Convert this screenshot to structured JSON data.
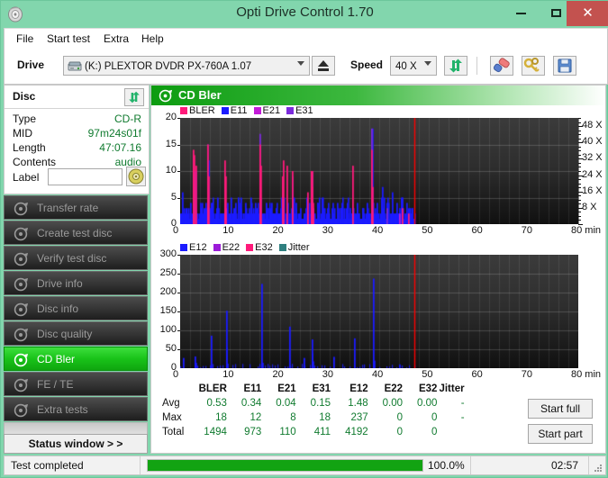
{
  "window": {
    "title": "Opti Drive Control 1.70",
    "icon": "disc-icon",
    "minimize": "minimize-icon",
    "maximize": "maximize-icon",
    "close": "✕"
  },
  "menu": {
    "items": [
      {
        "label": "File",
        "x": 8
      },
      {
        "label": "Start test",
        "x": 42
      },
      {
        "label": "Extra",
        "x": 105
      },
      {
        "label": "Help",
        "x": 147
      }
    ]
  },
  "toolbar": {
    "drive_label": "Drive",
    "drive_value": "(K:)   PLEXTOR DVDR   PX-760A 1.07",
    "eject_icon": "eject-icon",
    "speed_label": "Speed",
    "speed_value": "40 X",
    "refresh_icon": "refresh-icon",
    "erase_icon": "eraser-icon",
    "keys_icon": "keys-icon",
    "save_icon": "save-icon"
  },
  "disc_panel": {
    "title": "Disc",
    "refresh_icon": "refresh-icon",
    "rows": [
      {
        "label": "Type",
        "value": "CD-R"
      },
      {
        "label": "MID",
        "value": "97m24s01f"
      },
      {
        "label": "Length",
        "value": "47:07.16"
      },
      {
        "label": "Contents",
        "value": "audio"
      }
    ],
    "label_row": "Label",
    "label_value": "",
    "label_placeholder": "",
    "cd_button_icon": "cd-disc-icon"
  },
  "nav": {
    "items": [
      {
        "label": "Transfer rate",
        "icon": "disc-test-icon",
        "active": false
      },
      {
        "label": "Create test disc",
        "icon": "disc-create-icon",
        "active": false
      },
      {
        "label": "Verify test disc",
        "icon": "disc-verify-icon",
        "active": false
      },
      {
        "label": "Drive info",
        "icon": "disc-drive-icon",
        "active": false
      },
      {
        "label": "Disc info",
        "icon": "disc-info-icon",
        "active": false
      },
      {
        "label": "Disc quality",
        "icon": "disc-quality-icon",
        "active": false
      },
      {
        "label": "CD Bler",
        "icon": "disc-bler-icon",
        "active": true
      },
      {
        "label": "FE / TE",
        "icon": "disc-fete-icon",
        "active": false
      },
      {
        "label": "Extra tests",
        "icon": "disc-extra-icon",
        "active": false
      }
    ],
    "status_window_label": "Status window > >"
  },
  "content": {
    "header_title": "CD Bler",
    "header_icon": "disc-bler-icon",
    "start_full_label": "Start full",
    "start_part_label": "Start part"
  },
  "statusbar": {
    "message": "Test completed",
    "percent_label": "100.0%",
    "percent_value": 100.0,
    "elapsed": "02:57"
  },
  "colors": {
    "accent_green": "#12a312",
    "bler": "#ff1a7a",
    "e11": "#1b1bff",
    "e21": "#c31bd8",
    "e31": "#7b2bdb",
    "e12": "#1b1bff",
    "e22": "#9b1bd8",
    "e32": "#ff1a7a",
    "jitter": "#2f7f7f",
    "marker_red": "#ff0000",
    "title_bg": "#82d6ad",
    "close_bg": "#c3524f"
  },
  "stats": {
    "columns": [
      "BLER",
      "E11",
      "E21",
      "E31",
      "E12",
      "E22",
      "E32",
      "Jitter"
    ],
    "rows": [
      {
        "name": "Avg",
        "values": [
          "0.53",
          "0.34",
          "0.04",
          "0.15",
          "1.48",
          "0.00",
          "0.00",
          "-"
        ]
      },
      {
        "name": "Max",
        "values": [
          "18",
          "12",
          "8",
          "18",
          "237",
          "0",
          "0",
          "-"
        ]
      },
      {
        "name": "Total",
        "values": [
          "1494",
          "973",
          "110",
          "411",
          "4192",
          "0",
          "0",
          ""
        ]
      }
    ]
  },
  "chart_data": [
    {
      "type": "bar",
      "id": "cd-bler-chart",
      "title": "CD Bler",
      "xlabel": "min",
      "ylabel": "",
      "xlim": [
        0,
        80
      ],
      "ylim": [
        0,
        20
      ],
      "xticks": [
        0,
        10,
        20,
        30,
        40,
        50,
        60,
        70,
        80
      ],
      "xticklabels": [
        "0",
        "10",
        "20",
        "30",
        "40",
        "50",
        "60",
        "70",
        "80 min"
      ],
      "yticks": [
        0,
        5,
        10,
        15,
        20
      ],
      "yticklabels": [
        "0",
        "5",
        "10",
        "15",
        "20"
      ],
      "right_axis_label": "X",
      "right_yticks": [
        8,
        16,
        24,
        32,
        40,
        48
      ],
      "right_yticklabels": [
        "8 X",
        "16 X",
        "24 X",
        "32 X",
        "40 X",
        "48 X"
      ],
      "grid": true,
      "legend": [
        {
          "name": "BLER",
          "color": "#ff1a7a"
        },
        {
          "name": "E11",
          "color": "#1b1bff"
        },
        {
          "name": "E21",
          "color": "#c31bd8"
        },
        {
          "name": "E31",
          "color": "#7b2bdb"
        }
      ],
      "data_end_min": 47.1,
      "marker_line_min": 47.1,
      "series": [
        {
          "name": "BLER",
          "color": "#ff1a7a",
          "points": [
            [
              2.6,
              14
            ],
            [
              2.8,
              13
            ],
            [
              3.0,
              11
            ],
            [
              5.4,
              15
            ],
            [
              5.6,
              9
            ],
            [
              8.9,
              12
            ],
            [
              9.1,
              9
            ],
            [
              15.9,
              15
            ],
            [
              16.1,
              11
            ],
            [
              20.4,
              9
            ],
            [
              20.6,
              12
            ],
            [
              21.4,
              11
            ],
            [
              22.5,
              10
            ],
            [
              25.6,
              6
            ],
            [
              26.3,
              10
            ],
            [
              26.5,
              10
            ],
            [
              26.4,
              7
            ],
            [
              26.6,
              4
            ],
            [
              34.6,
              11
            ],
            [
              38.4,
              14
            ],
            [
              38.5,
              7
            ],
            [
              44.5,
              3
            ],
            [
              45.8,
              2
            ]
          ]
        },
        {
          "name": "E11",
          "color": "#1b1bff",
          "points": [
            [
              0.3,
              6
            ],
            [
              1.0,
              3
            ],
            [
              2.0,
              4
            ],
            [
              2.9,
              10
            ],
            [
              3.1,
              10
            ],
            [
              4.0,
              4
            ],
            [
              5.4,
              10
            ],
            [
              5.7,
              12
            ],
            [
              6.2,
              4
            ],
            [
              7.4,
              5
            ],
            [
              8.9,
              9
            ],
            [
              9.5,
              4
            ],
            [
              10.2,
              5
            ],
            [
              11.1,
              4
            ],
            [
              12.1,
              5
            ],
            [
              13.0,
              4
            ],
            [
              14.1,
              5
            ],
            [
              15.0,
              4
            ],
            [
              16.0,
              4
            ],
            [
              17.2,
              4
            ],
            [
              18.3,
              4
            ],
            [
              19.2,
              3
            ],
            [
              20.5,
              4
            ],
            [
              21.5,
              4
            ],
            [
              22.5,
              7
            ],
            [
              23.1,
              4
            ],
            [
              24.0,
              3
            ],
            [
              25.4,
              5
            ],
            [
              26.3,
              5
            ],
            [
              26.5,
              5
            ],
            [
              27.5,
              4
            ],
            [
              28.4,
              4
            ],
            [
              29.5,
              3
            ],
            [
              30.5,
              4
            ],
            [
              31.5,
              4
            ],
            [
              32.4,
              3
            ],
            [
              33.5,
              4
            ],
            [
              34.5,
              3
            ],
            [
              35.5,
              4
            ],
            [
              36.5,
              3
            ],
            [
              37.4,
              4
            ],
            [
              38.5,
              18
            ],
            [
              39.5,
              4
            ],
            [
              40.5,
              7
            ],
            [
              41.5,
              4
            ],
            [
              42.5,
              6
            ],
            [
              43.5,
              4
            ],
            [
              44.5,
              5
            ],
            [
              45.5,
              4
            ],
            [
              46.5,
              3
            ]
          ]
        },
        {
          "name": "E21",
          "color": "#c31bd8",
          "points": [
            [
              9.0,
              3
            ],
            [
              26.4,
              5
            ],
            [
              26.6,
              3
            ],
            [
              44.0,
              2
            ]
          ]
        },
        {
          "name": "E31",
          "color": "#7b2bdb",
          "points": [
            [
              5.5,
              15
            ],
            [
              15.9,
              17
            ],
            [
              22.4,
              9
            ],
            [
              26.5,
              10
            ],
            [
              38.4,
              18
            ],
            [
              41.5,
              3
            ]
          ]
        }
      ],
      "baseline_band": {
        "description": "Dense blue E11 baseline from 0 to 47 min, typical heights 1-3",
        "color": "#1b1bff",
        "from_min": 0,
        "to_min": 47,
        "height": 2
      }
    },
    {
      "type": "bar",
      "id": "cd-e12-chart",
      "title": "",
      "xlabel": "min",
      "ylabel": "",
      "xlim": [
        0,
        80
      ],
      "ylim": [
        0,
        300
      ],
      "xticks": [
        0,
        10,
        20,
        30,
        40,
        50,
        60,
        70,
        80
      ],
      "xticklabels": [
        "0",
        "10",
        "20",
        "30",
        "40",
        "50",
        "60",
        "70",
        "80 min"
      ],
      "yticks": [
        0,
        50,
        100,
        150,
        200,
        250,
        300
      ],
      "yticklabels": [
        "0",
        "50",
        "100",
        "150",
        "200",
        "250",
        "300"
      ],
      "grid": true,
      "legend": [
        {
          "name": "E12",
          "color": "#1b1bff"
        },
        {
          "name": "E22",
          "color": "#9b1bd8"
        },
        {
          "name": "E32",
          "color": "#ff1a7a"
        },
        {
          "name": "Jitter",
          "color": "#2f7f7f"
        }
      ],
      "data_end_min": 47.1,
      "marker_line_min": 47.1,
      "series": [
        {
          "name": "E12",
          "color": "#1b1bff",
          "points": [
            [
              0.6,
              27
            ],
            [
              2.9,
              31
            ],
            [
              3.0,
              14
            ],
            [
              6.2,
              86
            ],
            [
              9.2,
              152
            ],
            [
              9.3,
              55
            ],
            [
              9.4,
              12
            ],
            [
              16.3,
              223
            ],
            [
              16.4,
              14
            ],
            [
              21.9,
              110
            ],
            [
              24.8,
              27
            ],
            [
              26.4,
              76
            ],
            [
              26.5,
              40
            ],
            [
              26.6,
              18
            ],
            [
              30.7,
              30
            ],
            [
              34.9,
              79
            ],
            [
              38.8,
              237
            ],
            [
              38.9,
              20
            ],
            [
              44.0,
              10
            ]
          ]
        },
        {
          "name": "E22",
          "color": "#9b1bd8",
          "points": []
        },
        {
          "name": "E32",
          "color": "#ff1a7a",
          "points": []
        },
        {
          "name": "Jitter",
          "color": "#2f7f7f",
          "points": []
        }
      ]
    }
  ]
}
